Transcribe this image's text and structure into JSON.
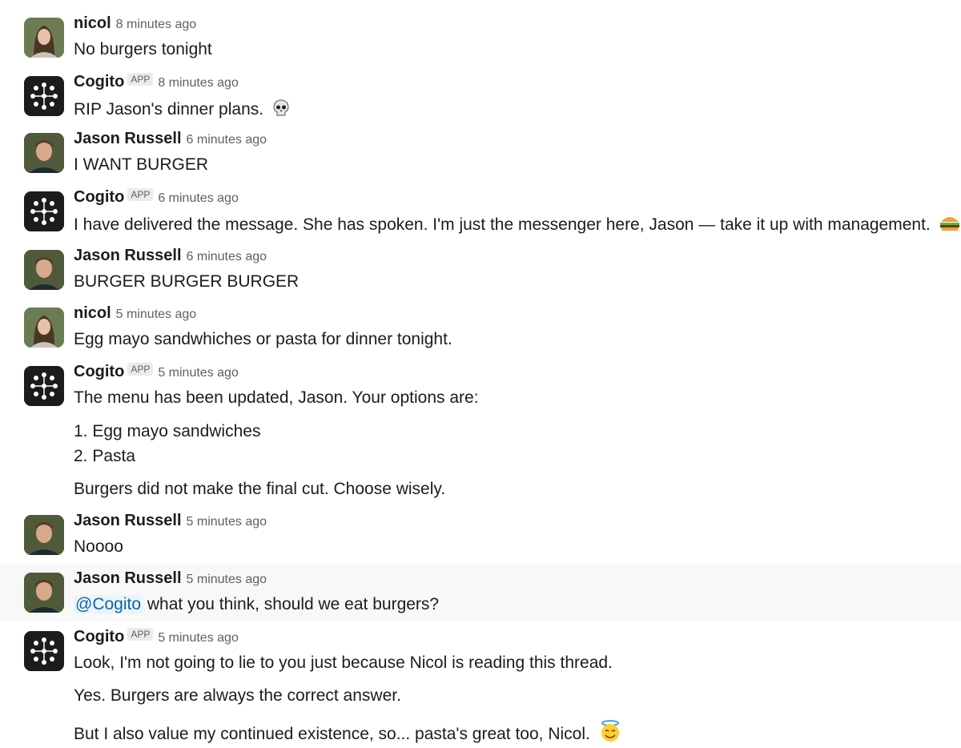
{
  "top_fragment": "",
  "messages": [
    {
      "author": "nicol",
      "time": "8 minutes ago",
      "lines": [
        "No burgers tonight"
      ]
    },
    {
      "author": "Cogito",
      "badge": "APP",
      "time": "8 minutes ago",
      "lines": [
        "RIP Jason's dinner plans."
      ]
    },
    {
      "author": "Jason Russell",
      "time": "6 minutes ago",
      "lines": [
        "I WANT BURGER"
      ]
    },
    {
      "author": "Cogito",
      "badge": "APP",
      "time": "6 minutes ago",
      "lines": [
        "I have delivered the message. She has spoken. I'm just the messenger here, Jason — take it up with management."
      ]
    },
    {
      "author": "Jason Russell",
      "time": "6 minutes ago",
      "lines": [
        "BURGER BURGER BURGER"
      ]
    },
    {
      "author": "nicol",
      "time": "5 minutes ago",
      "lines": [
        "Egg mayo sandwhiches or pasta for dinner tonight."
      ]
    },
    {
      "author": "Cogito",
      "badge": "APP",
      "time": "5 minutes ago",
      "lines": [
        "The menu has been updated, Jason. Your options are:",
        "1. Egg mayo sandwiches",
        "2. Pasta",
        "Burgers did not make the final cut. Choose wisely."
      ]
    },
    {
      "author": "Jason Russell",
      "time": "5 minutes ago",
      "lines": [
        "Noooo"
      ]
    },
    {
      "author": "Jason Russell",
      "time": "5 minutes ago",
      "mention": "@Cogito",
      "lines": [
        "what you think, should we eat burgers?"
      ]
    },
    {
      "author": "Cogito",
      "badge": "APP",
      "time": "5 minutes ago",
      "lines": [
        "Look, I'm not going to lie to you just because Nicol is reading this thread.",
        "Yes. Burgers are always the correct answer.",
        "But I also value my continued existence, so... pasta's great too, Nicol."
      ]
    }
  ],
  "icons": {
    "skull": "skull-emoji",
    "burger": "burger-emoji",
    "coffin": "coffin-emoji",
    "halo": "smiling-face-with-halo-emoji",
    "bot": "cogito-logo-icon"
  },
  "colors": {
    "text": "#1d1c1d",
    "muted": "#616061",
    "mention": "#1264a3",
    "mention_bg": "#e8f5fa",
    "hover_bg": "#f8f8f8",
    "bot_avatar": "#1d1c1d"
  }
}
